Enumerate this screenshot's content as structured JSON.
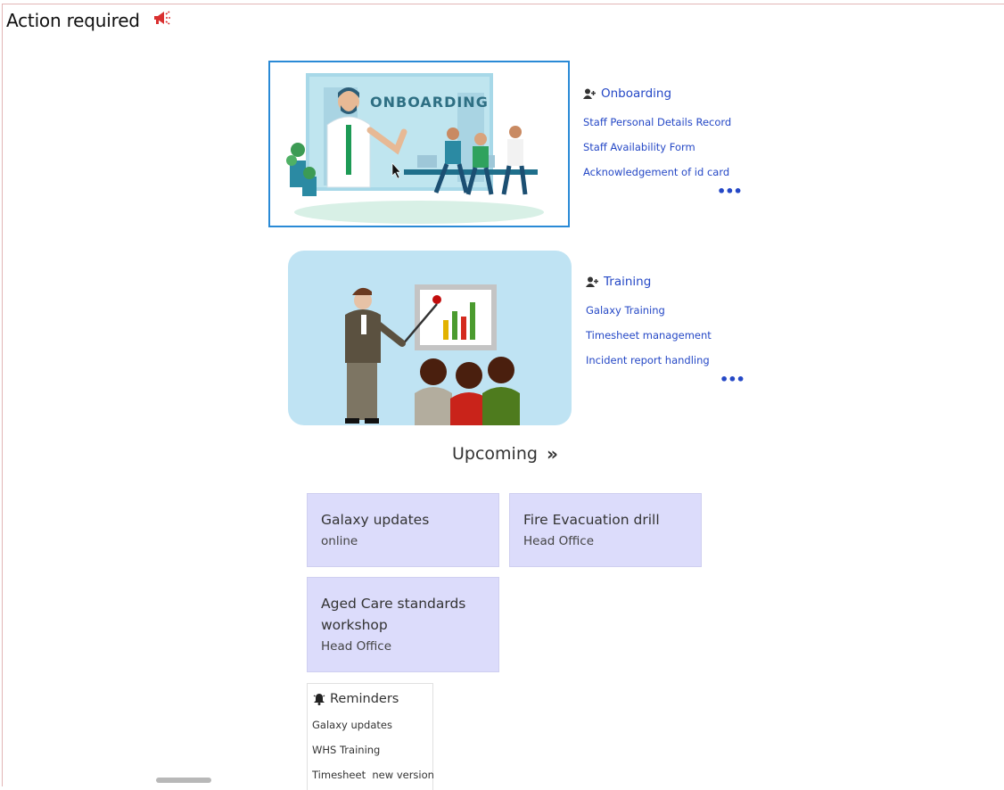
{
  "header": {
    "title": "Action required",
    "icon": "megaphone-icon",
    "icon_color": "#d93030"
  },
  "onboarding": {
    "image_text": "ONBOARDING",
    "heading": "Onboarding",
    "items": [
      "Staff Personal Details Record",
      "Staff Availability Form",
      "Acknowledgement of id card"
    ],
    "more": "•••"
  },
  "training": {
    "heading": "Training",
    "items": [
      "Galaxy Training",
      "Timesheet management",
      "Incident report handling"
    ],
    "more": "•••"
  },
  "upcoming": {
    "label": "Upcoming",
    "chevron": "»",
    "events": [
      {
        "title": "Galaxy updates",
        "location": "online"
      },
      {
        "title": "Fire Evacuation drill",
        "location": "Head Office"
      },
      {
        "title": "Aged Care standards workshop",
        "location": "Head Office"
      }
    ]
  },
  "reminders": {
    "heading": "Reminders",
    "items": [
      "Galaxy updates",
      "WHS Training",
      "Timesheet  new version"
    ]
  },
  "colors": {
    "link": "#2548c6",
    "event_bg": "#dcdcfb",
    "selected_border": "#2a8ad6"
  }
}
